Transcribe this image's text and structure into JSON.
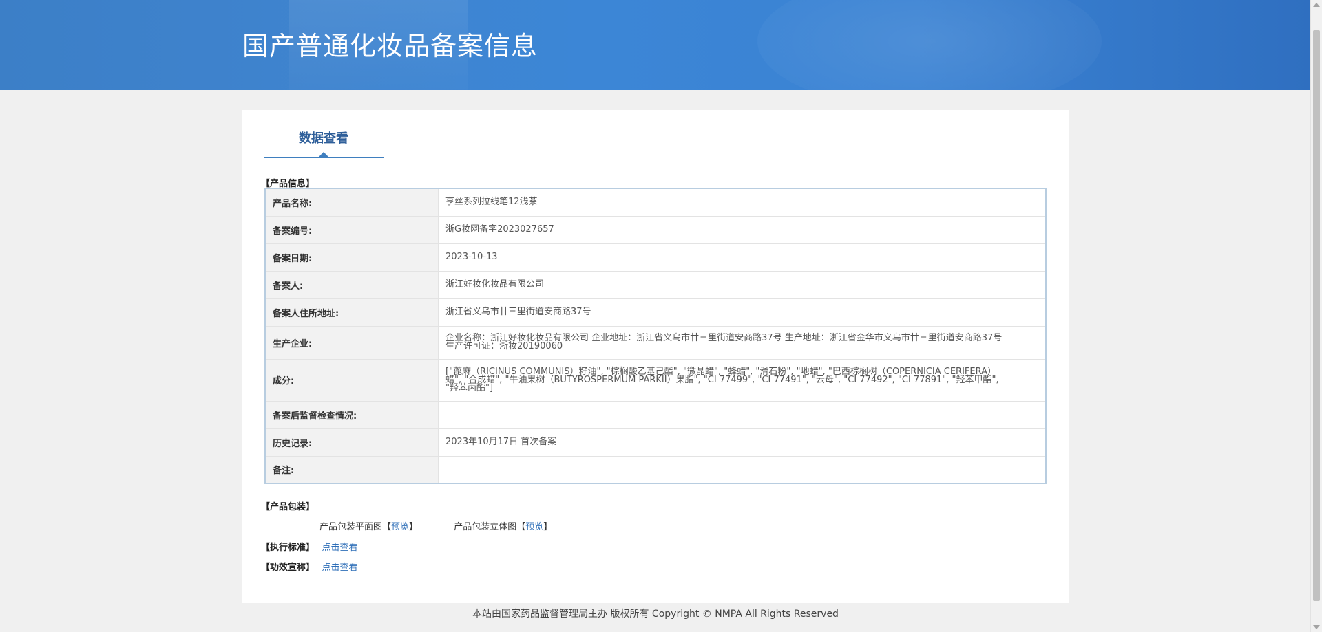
{
  "header": {
    "title": "国产普通化妆品备案信息"
  },
  "tabs": [
    {
      "label": "数据查看"
    }
  ],
  "product_info": {
    "section_label": "【产品信息】",
    "rows": [
      {
        "key": "产品名称:",
        "value": "亨丝系列拉线笔12浅茶"
      },
      {
        "key": "备案编号:",
        "value": "浙G妆网备字2023027657"
      },
      {
        "key": "备案日期:",
        "value": "2023-10-13"
      },
      {
        "key": "备案人:",
        "value": "浙江好妆化妆品有限公司"
      },
      {
        "key": "备案人住所地址:",
        "value": "浙江省义乌市廿三里街道安商路37号"
      },
      {
        "key": "生产企业:",
        "value": "企业名称：浙江好妆化妆品有限公司 企业地址：浙江省义乌市廿三里街道安商路37号 生产地址：浙江省金华市义乌市廿三里街道安商路37号 生产许可证：浙妆20190060"
      },
      {
        "key": "成分:",
        "value": "[\"蓖麻（RICINUS COMMUNIS）籽油\", \"棕榈酸乙基己酯\", \"微晶蜡\", \"蜂蜡\", \"滑石粉\", \"地蜡\", \"巴西棕榈树（COPERNICIA CERIFERA）蜡\", \"合成蜡\", \"牛油果树（BUTYROSPERMUM PARKII）果脂\", \"CI 77499\", \"CI 77491\", \"云母\", \"CI 77492\", \"CI 77891\", \"羟苯甲酯\", \"羟苯丙酯\"]"
      },
      {
        "key": "备案后监督检查情况:",
        "value": ""
      },
      {
        "key": "历史记录:",
        "value": "2023年10月17日 首次备案"
      },
      {
        "key": "备注:",
        "value": ""
      }
    ]
  },
  "packaging": {
    "section_label": "【产品包装】",
    "items": [
      {
        "label": "产品包装平面图",
        "bracket_open": "【",
        "link": "预览",
        "bracket_close": "】"
      },
      {
        "label": "产品包装立体图",
        "bracket_open": "【",
        "link": "预览",
        "bracket_close": "】"
      }
    ]
  },
  "standard": {
    "label": "【执行标准】",
    "link": "点击查看"
  },
  "efficacy": {
    "label": "【功效宣称】",
    "link": "点击查看"
  },
  "footer": {
    "text": "本站由国家药品监督管理局主办 版权所有 Copyright © NMPA All Rights Reserved"
  }
}
